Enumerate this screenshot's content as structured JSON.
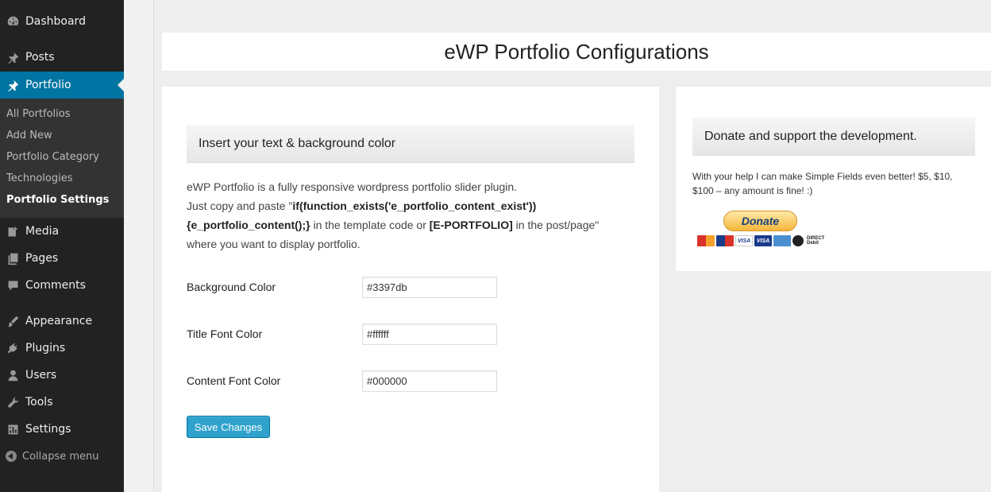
{
  "sidebar": {
    "items": [
      {
        "label": "Dashboard",
        "icon": "dashboard-icon"
      },
      {
        "label": "Posts",
        "icon": "pin-icon"
      },
      {
        "label": "Portfolio",
        "icon": "pin-icon"
      },
      {
        "label": "Media",
        "icon": "media-icon"
      },
      {
        "label": "Pages",
        "icon": "pages-icon"
      },
      {
        "label": "Comments",
        "icon": "comment-icon"
      },
      {
        "label": "Appearance",
        "icon": "brush-icon"
      },
      {
        "label": "Plugins",
        "icon": "plug-icon"
      },
      {
        "label": "Users",
        "icon": "user-icon"
      },
      {
        "label": "Tools",
        "icon": "wrench-icon"
      },
      {
        "label": "Settings",
        "icon": "settings-icon"
      }
    ],
    "submenu": [
      "All Portfolios",
      "Add New",
      "Portfolio Category",
      "Technologies",
      "Portfolio Settings"
    ],
    "collapse_label": "Collapse menu"
  },
  "page": {
    "title": "eWP Portfolio Configurations"
  },
  "main": {
    "section_title": "Insert your text & background color",
    "desc_line1": "eWP Portfolio is a fully responsive wordpress portfolio slider plugin.",
    "desc_line2_pre": "Just copy and paste \"",
    "desc_code1": "if(function_exists('e_portfolio_content_exist'))",
    "desc_code2": "{e_portfolio_content();}",
    "desc_mid": " in the template code or ",
    "desc_shortcode": "[E-PORTFOLIO]",
    "desc_post": " in the post/page\"",
    "desc_line4": "where you want to display portfolio.",
    "fields": [
      {
        "label": "Background Color",
        "value": "#3397db"
      },
      {
        "label": "Title Font Color",
        "value": "#ffffff"
      },
      {
        "label": "Content Font Color",
        "value": "#000000"
      }
    ],
    "save_label": "Save Changes"
  },
  "donate": {
    "title": "Donate and support the development.",
    "text": "With your help I can make Simple Fields even better! $5, $10, $100 – any amount is fine! :)",
    "button_label": "Donate",
    "debit_line1": "DIRECT",
    "debit_line2": "Debit"
  },
  "colors": {
    "sidebar_bg": "#222222",
    "active_bg": "#0074a2",
    "button_bg": "#2ea2cc"
  }
}
